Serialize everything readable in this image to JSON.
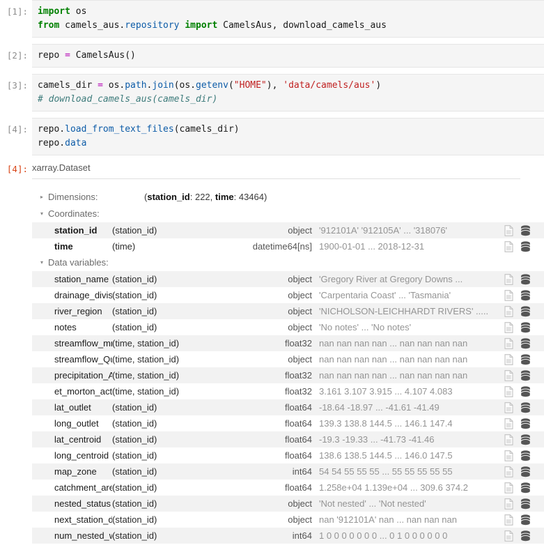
{
  "cells": [
    {
      "prompt": "[1]:",
      "lines": [
        [
          {
            "t": "import",
            "c": "k"
          },
          {
            "t": " os",
            "c": "p"
          }
        ],
        [
          {
            "t": "from",
            "c": "k"
          },
          {
            "t": " camels_aus.",
            "c": "p"
          },
          {
            "t": "repository",
            "c": "n"
          },
          {
            "t": " ",
            "c": "p"
          },
          {
            "t": "import",
            "c": "k"
          },
          {
            "t": " CamelsAus, download_camels_aus",
            "c": "p"
          }
        ]
      ]
    },
    {
      "prompt": "[2]:",
      "lines": [
        [
          {
            "t": "repo ",
            "c": "p"
          },
          {
            "t": "=",
            "c": "o"
          },
          {
            "t": " CamelsAus()",
            "c": "p"
          }
        ]
      ]
    },
    {
      "prompt": "[3]:",
      "lines": [
        [
          {
            "t": "camels_dir ",
            "c": "p"
          },
          {
            "t": "=",
            "c": "o"
          },
          {
            "t": " os.",
            "c": "p"
          },
          {
            "t": "path",
            "c": "n"
          },
          {
            "t": ".",
            "c": "p"
          },
          {
            "t": "join",
            "c": "n"
          },
          {
            "t": "(os.",
            "c": "p"
          },
          {
            "t": "getenv",
            "c": "n"
          },
          {
            "t": "(",
            "c": "p"
          },
          {
            "t": "\"HOME\"",
            "c": "s"
          },
          {
            "t": "), ",
            "c": "p"
          },
          {
            "t": "'data/camels/aus'",
            "c": "s"
          },
          {
            "t": ")",
            "c": "p"
          }
        ],
        [
          {
            "t": "# download_camels_aus(camels_dir)",
            "c": "c"
          }
        ]
      ]
    },
    {
      "prompt": "[4]:",
      "lines": [
        [
          {
            "t": "repo.",
            "c": "p"
          },
          {
            "t": "load_from_text_files",
            "c": "n"
          },
          {
            "t": "(camels_dir)",
            "c": "p"
          }
        ],
        [
          {
            "t": "repo.",
            "c": "p"
          },
          {
            "t": "data",
            "c": "n"
          }
        ]
      ]
    }
  ],
  "output": {
    "prompt": "[4]:",
    "obj_type": "xarray.Dataset",
    "dimensions": {
      "label": "Dimensions:",
      "triangle": "▸",
      "value_prefix": "(",
      "dims": [
        {
          "name": "station_id",
          "size": "222"
        },
        {
          "name": "time",
          "size": "43464"
        }
      ],
      "value_suffix": ")",
      "value_text": "(station_id: 222, time: 43464)"
    },
    "coordinates": {
      "label": "Coordinates:",
      "triangle": "▾",
      "rows": [
        {
          "name": "station_id",
          "dims": "(station_id)",
          "dtype": "object",
          "preview": "'912101A' '912105A' ... '318076'"
        },
        {
          "name": "time",
          "dims": "(time)",
          "dtype": "datetime64[ns]",
          "preview": "1900-01-01 ... 2018-12-31"
        }
      ]
    },
    "data_variables": {
      "label": "Data variables:",
      "triangle": "▾",
      "rows": [
        {
          "name": "station_name",
          "dims": "(station_id)",
          "dtype": "object",
          "preview": "'Gregory River at Gregory Downs ..."
        },
        {
          "name": "drainage_division",
          "dims": "(station_id)",
          "dtype": "object",
          "preview": "'Carpentaria Coast' ... 'Tasmania'"
        },
        {
          "name": "river_region",
          "dims": "(station_id)",
          "dtype": "object",
          "preview": "'NICHOLSON-LEICHHARDT RIVERS' ....."
        },
        {
          "name": "notes",
          "dims": "(station_id)",
          "dtype": "object",
          "preview": "'No notes' ... 'No notes'"
        },
        {
          "name": "streamflow_mmd",
          "dims": "(time, station_id)",
          "dtype": "float32",
          "preview": "nan nan nan nan ... nan nan nan nan"
        },
        {
          "name": "streamflow_Qu…",
          "dims": "(time, station_id)",
          "dtype": "object",
          "preview": "nan nan nan nan ... nan nan nan nan"
        },
        {
          "name": "precipitation_A…",
          "dims": "(time, station_id)",
          "dtype": "float32",
          "preview": "nan nan nan nan ... nan nan nan nan"
        },
        {
          "name": "et_morton_actu…",
          "dims": "(time, station_id)",
          "dtype": "float32",
          "preview": "3.161 3.107 3.915 ... 4.107 4.083"
        },
        {
          "name": "lat_outlet",
          "dims": "(station_id)",
          "dtype": "float64",
          "preview": "-18.64 -18.97 ... -41.61 -41.49"
        },
        {
          "name": "long_outlet",
          "dims": "(station_id)",
          "dtype": "float64",
          "preview": "139.3 138.8 144.5 ... 146.1 147.4"
        },
        {
          "name": "lat_centroid",
          "dims": "(station_id)",
          "dtype": "float64",
          "preview": "-19.3 -19.33 ... -41.73 -41.46"
        },
        {
          "name": "long_centroid",
          "dims": "(station_id)",
          "dtype": "float64",
          "preview": "138.6 138.5 144.5 ... 146.0 147.5"
        },
        {
          "name": "map_zone",
          "dims": "(station_id)",
          "dtype": "int64",
          "preview": "54 54 55 55 55 ... 55 55 55 55 55"
        },
        {
          "name": "catchment_area",
          "dims": "(station_id)",
          "dtype": "float64",
          "preview": "1.258e+04 1.139e+04 ... 309.6 374.2"
        },
        {
          "name": "nested_status",
          "dims": "(station_id)",
          "dtype": "object",
          "preview": "'Not nested' ... 'Not nested'"
        },
        {
          "name": "next_station_ds",
          "dims": "(station_id)",
          "dtype": "object",
          "preview": "nan '912101A' nan ... nan nan nan"
        },
        {
          "name": "num_nested_wi…",
          "dims": "(station_id)",
          "dtype": "int64",
          "preview": "1 0 0 0 0 0 0 0 ... 0 1 0 0 0 0 0 0"
        }
      ]
    },
    "icons": {
      "attrs": "document-icon",
      "data": "database-icon"
    }
  },
  "colors": {
    "keyword": "#008000",
    "name": "#0d5ca8",
    "string": "#c02020",
    "operator": "#b300b3",
    "comment": "#3d7b7b",
    "out_prompt": "#d84315",
    "cell_bg": "#f5f5f5",
    "row_stripe": "#f2f2f2"
  }
}
